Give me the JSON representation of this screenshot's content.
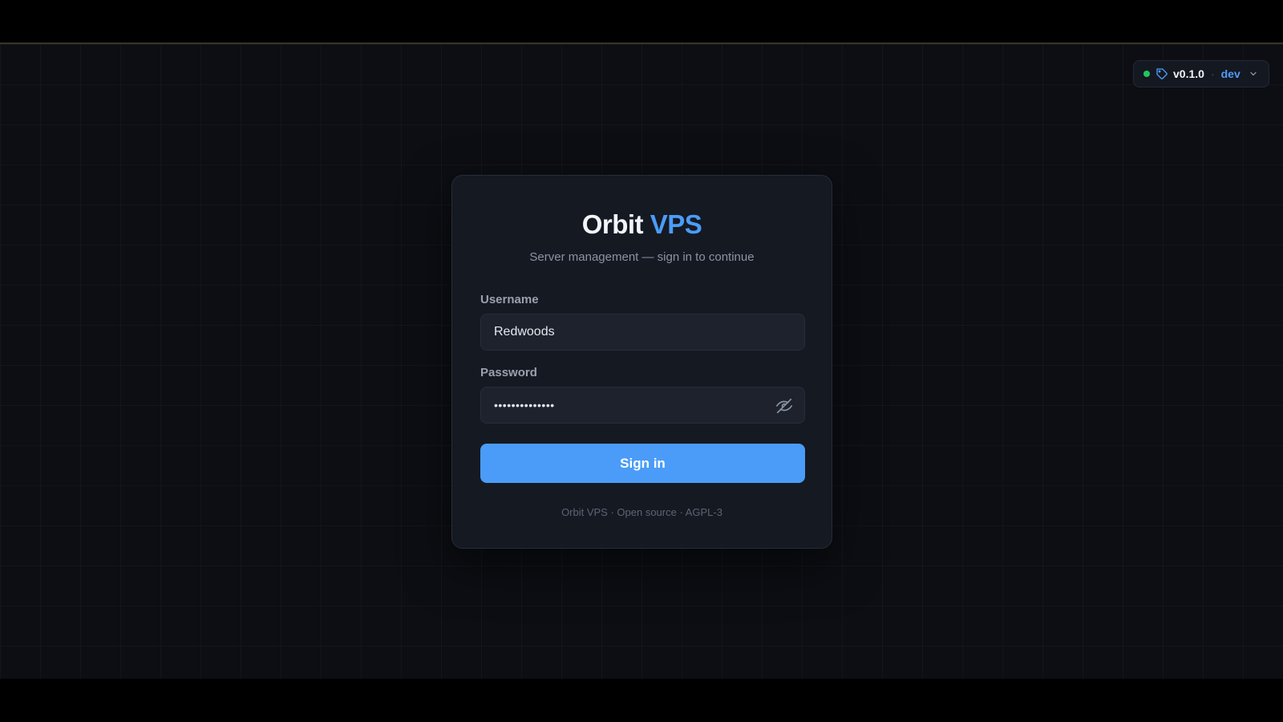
{
  "version_badge": {
    "version": "v0.1.0",
    "separator": "·",
    "branch": "dev",
    "status_color": "#22c55e",
    "icons": [
      "tag-icon",
      "chevron-down-icon"
    ]
  },
  "login": {
    "brand_primary": "Orbit",
    "brand_accent": "VPS",
    "subtitle": "Server management — sign in to continue",
    "username_label": "Username",
    "username_value": "Redwoods",
    "password_label": "Password",
    "password_masked": "••••••••••••••",
    "password_toggle_icon": "eye-off-icon",
    "submit_label": "Sign in",
    "footer": "Orbit VPS · Open source · AGPL-3"
  },
  "colors": {
    "accent": "#4a9cf8",
    "background": "#0c0e13",
    "card": "#151922"
  }
}
